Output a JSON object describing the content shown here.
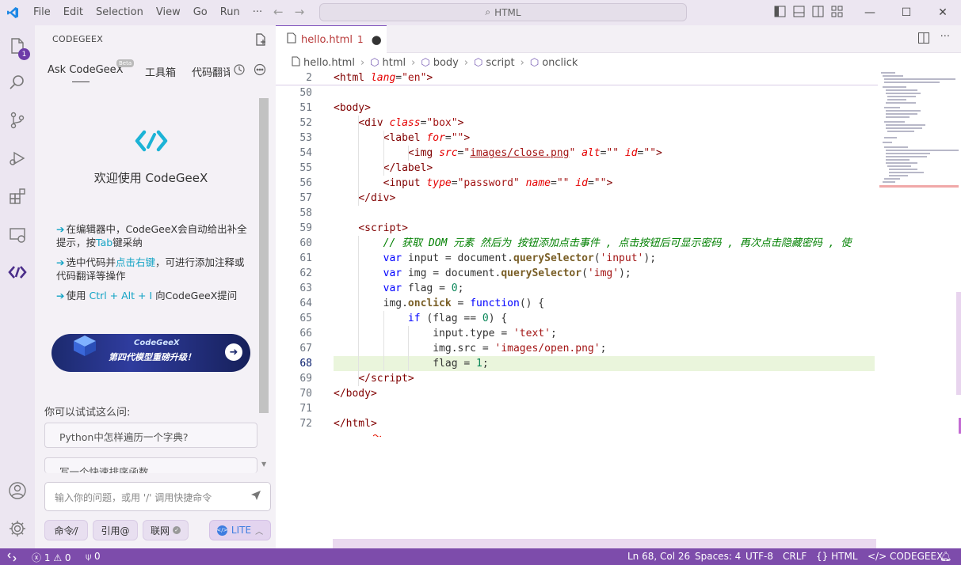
{
  "titlebar": {
    "menu": [
      "File",
      "Edit",
      "Selection",
      "View",
      "Go",
      "Run",
      "···"
    ],
    "search": "HTML",
    "colors": {
      "bar": "#ece6f1",
      "vscode_logo": "#1e88e5"
    }
  },
  "activity": {
    "icons": [
      "explorer-icon",
      "search-icon",
      "source-control-icon",
      "run-debug-icon",
      "extensions-icon",
      "remote-explorer-icon",
      "codegeex-icon",
      "account-icon",
      "settings-gear-icon"
    ],
    "explorer_badge": "1"
  },
  "sidebar": {
    "title": "CODEGEEX",
    "tabs": [
      "Ask CodeGeeX",
      "工具箱",
      "代码翻译"
    ],
    "beta": "Beta",
    "welcome": "欢迎使用 CodeGeeX",
    "tip1_a": "在编辑器中，CodeGeeX会自动给出补全提示，按",
    "tip1_tab": "Tab",
    "tip1_b": "键采纳",
    "tip2_a": "选中代码并",
    "tip2_hl": "点击右键",
    "tip2_b": "，可进行添加注释或代码翻译等操作",
    "tip3_a": "使用 ",
    "tip3_hl": "Ctrl + Alt + I",
    "tip3_b": " 向CodeGeeX提问",
    "banner_title": "CodeGeeX",
    "banner_sub": "第四代模型重磅升级！",
    "try_label": "你可以试试这么问:",
    "suggestions": [
      "Python中怎样遍历一个字典?",
      "写一个快速排序函数"
    ],
    "input_placeholder": "输入你的问题，或用 '/' 调用快捷命令",
    "chips": [
      "命令⁄/",
      "引用@",
      "联网"
    ],
    "lite": "LITE"
  },
  "editor": {
    "tab_name": "hello.html",
    "tab_problems": "1",
    "breadcrumbs": [
      "hello.html",
      "html",
      "body",
      "script",
      "onclick"
    ],
    "current_line": 68
  },
  "code_lines": [
    {
      "n": "2",
      "html": "<span class='tg'>&lt;html</span> <span class='at'>lang</span>=<span class='av2'>\"en\"</span><span class='tg'>&gt;</span>"
    },
    {
      "n": "50",
      "html": ""
    },
    {
      "n": "51",
      "html": "<span class='tg'>&lt;body&gt;</span>"
    },
    {
      "n": "52",
      "html": "    <span class='tg'>&lt;div</span> <span class='at'>class</span>=<span class='av2'>\"box\"</span><span class='tg'>&gt;</span>"
    },
    {
      "n": "53",
      "html": "        <span class='tg'>&lt;label</span> <span class='at'>for</span>=<span class='av2'>\"\"</span><span class='tg'>&gt;</span>"
    },
    {
      "n": "54",
      "html": "            <span class='tg'>&lt;img</span> <span class='at'>src</span>=<span class='av2'>\"<u>images/close.png</u>\"</span> <span class='at'>alt</span>=<span class='av2'>\"\"</span> <span class='at'>id</span>=<span class='av2'>\"\"</span><span class='tg'>&gt;</span>"
    },
    {
      "n": "55",
      "html": "        <span class='tg'>&lt;/label&gt;</span>"
    },
    {
      "n": "56",
      "html": "        <span class='tg'>&lt;input</span> <span class='at'>type</span>=<span class='av2'>\"password\"</span> <span class='at'>name</span>=<span class='av2'>\"\"</span> <span class='at'>id</span>=<span class='av2'>\"\"</span><span class='tg'>&gt;</span>"
    },
    {
      "n": "57",
      "html": "    <span class='tg'>&lt;/div&gt;</span>"
    },
    {
      "n": "58",
      "html": ""
    },
    {
      "n": "59",
      "html": "    <span class='tg'>&lt;script&gt;</span>"
    },
    {
      "n": "60",
      "html": "        <span class='cm'>// 获取 DOM 元素 然后为 按钮添加点击事件 , 点击按钮后可显示密码 , 再次点击隐藏密码 , 使</span>"
    },
    {
      "n": "61",
      "html": "        <span class='kw'>var</span> input = document.<span class='fn'>querySelector</span>(<span class='av2'>'input'</span>);"
    },
    {
      "n": "62",
      "html": "        <span class='kw'>var</span> img = document.<span class='fn'>querySelector</span>(<span class='av2'>'img'</span>);"
    },
    {
      "n": "63",
      "html": "        <span class='kw'>var</span> flag = <span class='num'>0</span>;"
    },
    {
      "n": "64",
      "html": "        img.<span class='fn'>onclick</span> = <span class='kw'>function</span>() {"
    },
    {
      "n": "65",
      "html": "            <span class='kw'>if</span> (flag == <span class='num'>0</span>) {"
    },
    {
      "n": "66",
      "html": "                input.type = <span class='av2'>'text'</span>;"
    },
    {
      "n": "67",
      "html": "                img.src = <span class='av2'>'images/open.png'</span>;"
    },
    {
      "n": "68",
      "html": "                flag = <span class='num'>1</span>;"
    },
    {
      "n": "69",
      "html": "    <span class='tg'>&lt;/script&gt;</span>"
    },
    {
      "n": "70",
      "html": "<span class='tg'>&lt;/body&gt;</span>"
    },
    {
      "n": "71",
      "html": ""
    },
    {
      "n": "72",
      "html": "<span class='tg'>&lt;/html&gt;</span>"
    }
  ],
  "status": {
    "errors": "1",
    "warnings": "0",
    "ports": "0",
    "position": "Ln 68, Col 26",
    "spaces": "Spaces: 4",
    "encoding": "UTF-8",
    "eol": "CRLF",
    "language": "HTML",
    "codegeex": "CODEGEEX",
    "colors": {
      "statusbar": "#7d4cab"
    }
  }
}
